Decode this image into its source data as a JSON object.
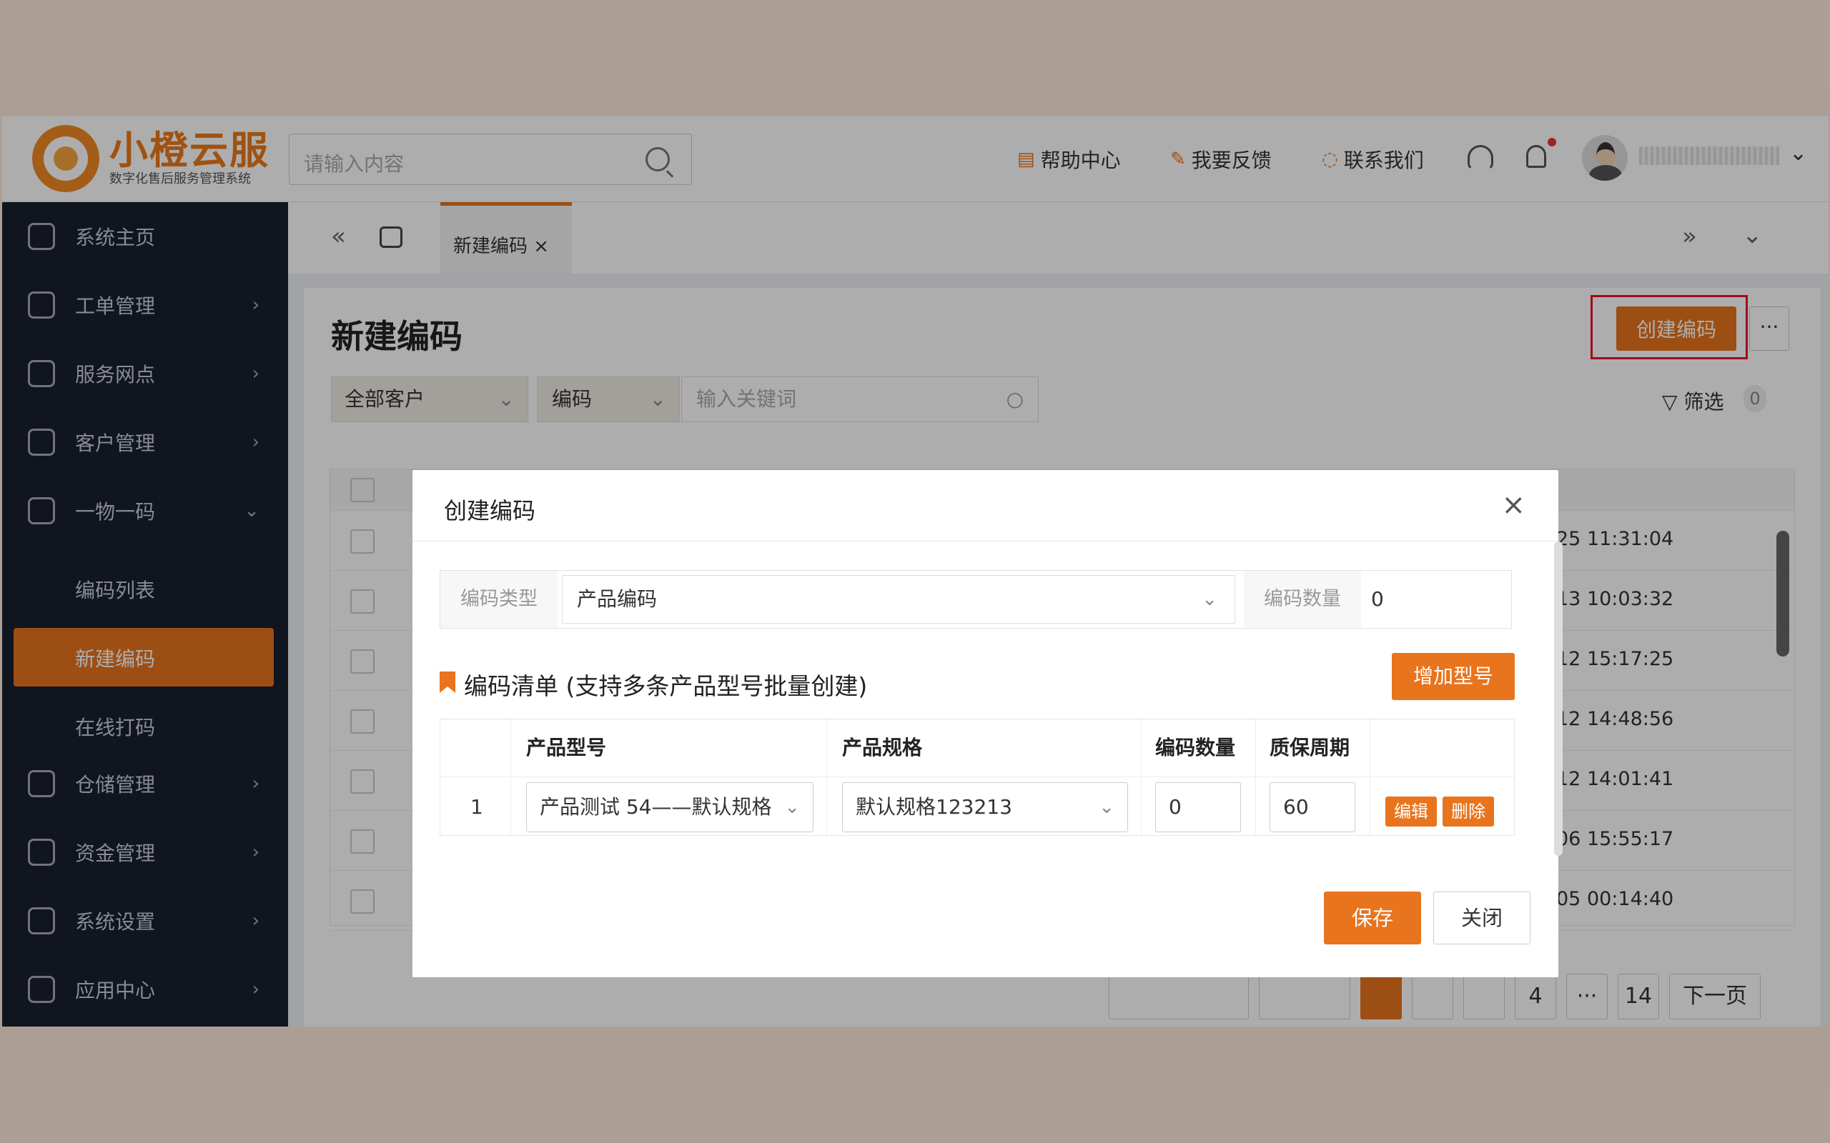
{
  "header": {
    "brand_title": "小橙云服",
    "brand_subtitle": "数字化售后服务管理系统",
    "search_placeholder": "请输入内容",
    "links": [
      "帮助中心",
      "我要反馈",
      "联系我们"
    ]
  },
  "sidebar": {
    "items": [
      "系统主页",
      "工单管理",
      "服务网点",
      "客户管理",
      "一物一码",
      "仓储管理",
      "资金管理",
      "系统设置",
      "应用中心"
    ],
    "sub_items": [
      "编码列表",
      "新建编码",
      "在线打码"
    ]
  },
  "tabs": {
    "active": "新建编码",
    "close": "×"
  },
  "page": {
    "title": "新建编码",
    "create_button": "创建编码",
    "more": "···",
    "filter_customer": "全部客户",
    "filter_field": "编码",
    "keyword_placeholder": "输入关键词",
    "filter_label": "筛选",
    "filter_count": "0"
  },
  "table": {
    "times": [
      "25 11:31:04",
      "13 10:03:32",
      "12 15:17:25",
      "12 14:48:56",
      "12 14:01:41",
      "06 15:55:17",
      "05 00:14:40"
    ]
  },
  "pager": {
    "page_partial": "4",
    "ellipsis": "···",
    "last": "14",
    "next": "下一页"
  },
  "dialog": {
    "title": "创建编码",
    "close_icon": "×",
    "code_type_label": "编码类型",
    "code_type_value": "产品编码",
    "code_count_label": "编码数量",
    "code_count_value": "0",
    "list_title": "编码清单 (支持多条产品型号批量创建)",
    "add_model": "增加型号",
    "columns": [
      "产品型号",
      "产品规格",
      "编码数量",
      "质保周期"
    ],
    "row": {
      "index": "1",
      "model": "产品测试 54——默认规格",
      "spec": "默认规格123213",
      "count": "0",
      "warranty": "60",
      "edit": "编辑",
      "delete": "删除"
    },
    "save": "保存",
    "close": "关闭"
  },
  "colors": {
    "accent": "#e8741d",
    "sidebar": "#18202f",
    "highlight": "#e12222"
  }
}
